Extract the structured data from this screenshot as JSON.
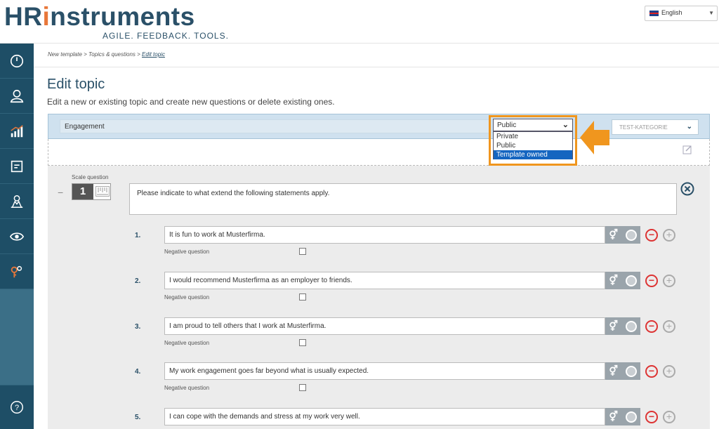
{
  "brand": {
    "name_hr": "HR",
    "name_i": "i",
    "name_rest": "nstruments",
    "tagline": "AGILE. FEEDBACK. TOOLS."
  },
  "language": {
    "selected": "English",
    "flag": "uk-flag-icon"
  },
  "sidebar": {
    "items": [
      {
        "icon": "dashboard-icon"
      },
      {
        "icon": "user-icon"
      },
      {
        "icon": "chart-icon"
      },
      {
        "icon": "document-icon"
      },
      {
        "icon": "team-icon"
      },
      {
        "icon": "eye-icon"
      },
      {
        "icon": "key-icon"
      }
    ],
    "help_icon": "help-icon"
  },
  "breadcrumb": {
    "part1": "New template",
    "sep": " > ",
    "part2": "Topics & questions",
    "current": "Edit topic"
  },
  "page": {
    "title": "Edit topic",
    "subtitle": "Edit a new or existing topic and create new questions or delete existing ones."
  },
  "topic": {
    "name": "Engagement",
    "visibility": {
      "selected": "Public",
      "options": [
        "Private",
        "Public",
        "Template owned"
      ],
      "highlighted": "Template owned"
    },
    "category": "TEST-KATEGORIE"
  },
  "question": {
    "type_label": "Scale question",
    "number": "1",
    "text": "Please indicate to what extend the following statements apply.",
    "negative_label": "Negative question",
    "items": [
      {
        "num": "1.",
        "text": "It is fun to work at Musterfirma."
      },
      {
        "num": "2.",
        "text": "I would recommend Musterfirma as an employer to friends."
      },
      {
        "num": "3.",
        "text": "I am proud to tell others that I work at Musterfirma."
      },
      {
        "num": "4.",
        "text": "My work engagement goes far beyond what is usually expected."
      },
      {
        "num": "5.",
        "text": "I can cope with the demands and stress at my work very well."
      }
    ]
  },
  "colors": {
    "brand": "#2a5068",
    "accent": "#e8773a",
    "highlight": "#f0961e",
    "sidebar": "#1e4e66"
  }
}
